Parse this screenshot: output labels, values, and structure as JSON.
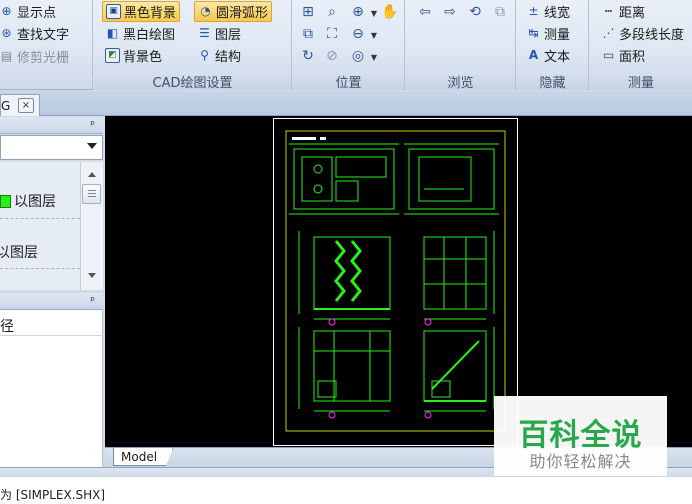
{
  "ribbon": {
    "group0": {
      "items": [
        "显示点",
        "查找文字",
        "修剪光栅"
      ]
    },
    "cad_settings": {
      "label": "CAD绘图设置",
      "black_bg": "黑色背景",
      "smooth_arc": "圆滑弧形",
      "bw_draw": "黑白绘图",
      "layers": "图层",
      "bg_color": "背景色",
      "structure": "结构"
    },
    "position": {
      "label": "位置"
    },
    "browse": {
      "label": "浏览"
    },
    "hide": {
      "label": "隐藏",
      "line_width": "线宽",
      "measure": "测量",
      "text": "文本"
    },
    "measure": {
      "label": "测量",
      "distance": "距离",
      "polyline_length": "多段线长度",
      "area": "面积"
    }
  },
  "doc_tab": {
    "label": "G",
    "close": "×"
  },
  "layer_panel": {
    "pin": "ᵖ",
    "rows": [
      "以图层",
      "以图层"
    ],
    "swatch_color": "#2aef18"
  },
  "path_panel": {
    "pin": "ᵖ",
    "label": "径"
  },
  "canvas": {
    "background": "#000000",
    "accent": "#2aef18"
  },
  "model_tab": "Model",
  "command_line": "为 [SIMPLEX.SHX]",
  "watermark": {
    "title": "百科全说",
    "subtitle": "助你轻松解决"
  }
}
